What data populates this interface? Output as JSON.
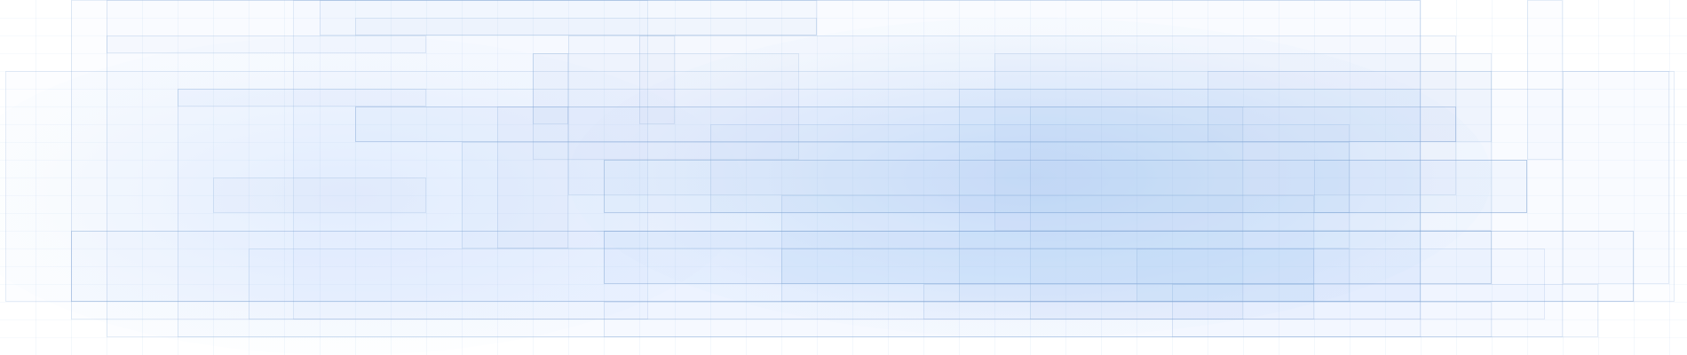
{
  "palette": {
    "background": "#ffffff",
    "tint_light": "#f4f8fd",
    "tint_mid": "#e6f0fb",
    "tint_strong": "#d9e9fa",
    "grid_line": "#9bb8dc"
  }
}
